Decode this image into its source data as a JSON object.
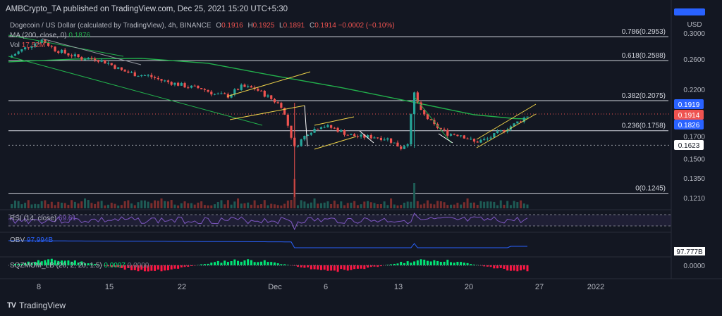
{
  "header": {
    "publisher": "AMBCrypto_TA published on TradingView.com, Dec 25, 2021 15:20 UTC+5:30"
  },
  "legend": {
    "symbol": "Dogecoin / US Dollar (calculated by TradingView), 4h, BINANCE",
    "o_label": "O",
    "o": "0.1916",
    "h_label": "H",
    "h": "0.1925",
    "l_label": "L",
    "l": "0.1891",
    "c_label": "C",
    "c": "0.1914",
    "change": "−0.0002 (−0.10%)",
    "ma_label": "MA (200, close, 0)",
    "ma_value": "0.1876",
    "vol_label": "Vol",
    "vol_value": "17.52M"
  },
  "panes": {
    "rsi": {
      "label": "RSI (14, close)",
      "value": "69.61"
    },
    "obv": {
      "label": "OBV",
      "value": "97.994B",
      "axis_tag": "97.777B"
    },
    "sqz": {
      "label": "SQZMOM_LB (20, 2, 20, 1.5)",
      "value1": "0.0097",
      "value2": "0.0000",
      "axis_tick": "0.0000"
    }
  },
  "watermark": {
    "text": "TradingView",
    "logo": "TV"
  },
  "colors": {
    "bg": "#131722",
    "up": "#26a69a",
    "down": "#ef5350",
    "ma": "#22b14c",
    "fib": "#d1d4dc",
    "channel": "#f0d44a",
    "rsi": "#7e57c2",
    "obv": "#2962ff",
    "sqz_pos": "#00e676",
    "sqz_neg": "#ff1744"
  },
  "chart_data": {
    "type": "candlestick",
    "title": "Dogecoin / US Dollar, 4h, BINANCE",
    "currency": "USD",
    "y_axis_ticks": [
      "0.3000",
      "0.2600",
      "0.2200",
      "0.1700",
      "0.1500",
      "0.1350",
      "0.1210"
    ],
    "x_axis_ticks": [
      "8",
      "15",
      "22",
      "Dec",
      "6",
      "13",
      "20",
      "27",
      "2022"
    ],
    "fib_levels": [
      {
        "label": "0.786(0.2953)",
        "value": 0.2953
      },
      {
        "label": "0.618(0.2588)",
        "value": 0.2588
      },
      {
        "label": "0.382(0.2075)",
        "value": 0.2075
      },
      {
        "label": "0.236(0.1758)",
        "value": 0.1758
      },
      {
        "label": "0(0.1245)",
        "value": 0.1245
      }
    ],
    "support_dotted": {
      "label": "0.1623",
      "value": 0.1623
    },
    "price_tags": [
      {
        "label": "0.1919",
        "color": "#2962ff"
      },
      {
        "label": "0.1914",
        "color": "#ef5350"
      },
      {
        "label": "0.1826",
        "color": "#2962ff"
      },
      {
        "label": "0.1623",
        "color": "#ffffff"
      }
    ],
    "price_path": [
      [
        0,
        0.263
      ],
      [
        6,
        0.28
      ],
      [
        10,
        0.29
      ],
      [
        14,
        0.275
      ],
      [
        18,
        0.268
      ],
      [
        22,
        0.262
      ],
      [
        26,
        0.262
      ],
      [
        30,
        0.255
      ],
      [
        34,
        0.245
      ],
      [
        38,
        0.24
      ],
      [
        42,
        0.238
      ],
      [
        46,
        0.232
      ],
      [
        50,
        0.228
      ],
      [
        54,
        0.224
      ],
      [
        58,
        0.222
      ],
      [
        62,
        0.215
      ],
      [
        66,
        0.213
      ],
      [
        70,
        0.224
      ],
      [
        74,
        0.222
      ],
      [
        78,
        0.212
      ],
      [
        82,
        0.202
      ],
      [
        86,
        0.16
      ],
      [
        90,
        0.174
      ],
      [
        94,
        0.181
      ],
      [
        98,
        0.178
      ],
      [
        102,
        0.172
      ],
      [
        106,
        0.17
      ],
      [
        110,
        0.17
      ],
      [
        114,
        0.168
      ],
      [
        118,
        0.16
      ],
      [
        120,
        0.165
      ],
      [
        122,
        0.216
      ],
      [
        124,
        0.195
      ],
      [
        128,
        0.181
      ],
      [
        132,
        0.173
      ],
      [
        136,
        0.172
      ],
      [
        140,
        0.165
      ],
      [
        144,
        0.168
      ],
      [
        148,
        0.175
      ],
      [
        152,
        0.182
      ],
      [
        156,
        0.191
      ]
    ],
    "ma200_path": [
      [
        0,
        0.257
      ],
      [
        20,
        0.261
      ],
      [
        40,
        0.262
      ],
      [
        60,
        0.255
      ],
      [
        80,
        0.238
      ],
      [
        100,
        0.223
      ],
      [
        120,
        0.207
      ],
      [
        140,
        0.192
      ],
      [
        152,
        0.188
      ],
      [
        156,
        0.1876
      ]
    ]
  }
}
